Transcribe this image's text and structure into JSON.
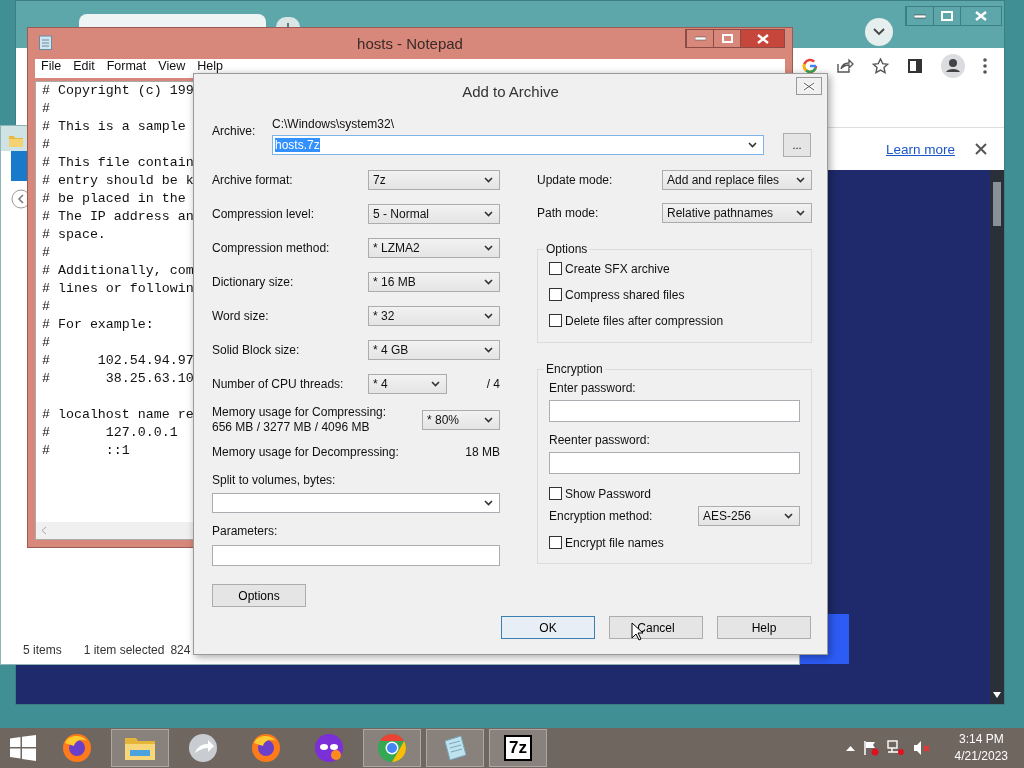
{
  "browser": {
    "infobar_link": "Learn more"
  },
  "explorer": {
    "status_items": "5 items",
    "status_selected": "1 item selected",
    "status_size": "824"
  },
  "notepad": {
    "title": "hosts - Notepad",
    "menu": [
      "File",
      "Edit",
      "Format",
      "View",
      "Help"
    ],
    "paragraphs": [
      [
        "# Copyright (c) 199",
        "#",
        "# This is a sample",
        "#",
        "# This file contain",
        "# entry should be k",
        "# be placed in the",
        "# The IP address an",
        "# space.",
        "#",
        "# Additionally, com",
        "# lines or followin",
        "#",
        "# For example:",
        "#",
        "#      102.54.94.97",
        "#       38.25.63.10"
      ],
      [
        "# localhost name re",
        "#       127.0.0.1",
        "#       ::1"
      ]
    ]
  },
  "dialog": {
    "title": "Add to Archive",
    "archive": {
      "label": "Archive:",
      "folder": "C:\\Windows\\system32\\",
      "name": "hosts.7z",
      "name_selected": true,
      "browse": "..."
    },
    "settings": [
      {
        "label": "Archive format:",
        "value": "7z"
      },
      {
        "label": "Compression level:",
        "value": "5 - Normal"
      },
      {
        "label": "Compression method:",
        "value": "* LZMA2"
      },
      {
        "label": "Dictionary size:",
        "value": "* 16 MB"
      },
      {
        "label": "Word size:",
        "value": "* 32"
      },
      {
        "label": "Solid Block size:",
        "value": "* 4 GB"
      }
    ],
    "cpu_threads": {
      "label": "Number of CPU threads:",
      "value": "* 4",
      "max": "/ 4"
    },
    "memory_compress": {
      "label": "Memory usage for Compressing:",
      "detail": "656 MB / 3277 MB / 4096 MB",
      "value": "* 80%"
    },
    "memory_decompress": {
      "label": "Memory usage for Decompressing:",
      "value": "18 MB"
    },
    "split": {
      "label": "Split to volumes, bytes:"
    },
    "parameters": {
      "label": "Parameters:"
    },
    "options_button": "Options",
    "update_mode": {
      "label": "Update mode:",
      "value": "Add and replace files"
    },
    "path_mode": {
      "label": "Path mode:",
      "value": "Relative pathnames"
    },
    "options_group": {
      "title": "Options",
      "checkboxes": [
        {
          "label": "Create SFX archive",
          "checked": false
        },
        {
          "label": "Compress shared files",
          "checked": false
        },
        {
          "label": "Delete files after compression",
          "checked": false
        }
      ]
    },
    "encryption": {
      "title": "Encryption",
      "enter_label": "Enter password:",
      "reenter_label": "Reenter password:",
      "show_password": {
        "label": "Show Password",
        "checked": false
      },
      "method_label": "Encryption method:",
      "method_value": "AES-256",
      "encrypt_names": {
        "label": "Encrypt file names",
        "checked": false
      }
    },
    "buttons": [
      {
        "label": "OK",
        "default": true
      },
      {
        "label": "Cancel",
        "default": false
      },
      {
        "label": "Help",
        "default": false
      }
    ]
  },
  "taskbar": {
    "apps": [
      {
        "kind": "firefox",
        "running": false
      },
      {
        "kind": "explorer",
        "running": true
      },
      {
        "kind": "shortcut",
        "running": false
      },
      {
        "kind": "firefox",
        "running": false
      },
      {
        "kind": "mask",
        "running": false
      },
      {
        "kind": "chrome",
        "running": true
      },
      {
        "kind": "notepad",
        "running": true
      },
      {
        "kind": "sevenzip",
        "running": true,
        "label": "7z"
      }
    ],
    "time": "3:14 PM",
    "date": "4/21/2023"
  }
}
